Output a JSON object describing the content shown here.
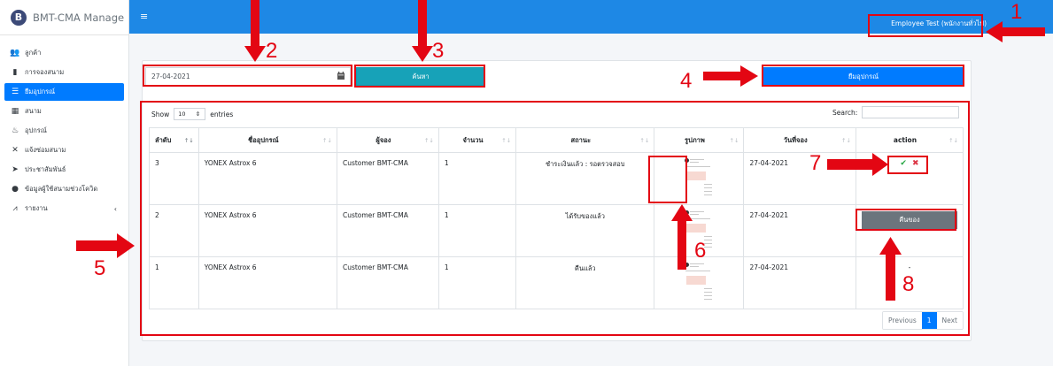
{
  "app": {
    "brand_letter": "B",
    "brand_name": "BMT-CMA Manage",
    "menu_icon": "hamburger-icon"
  },
  "sidebar": {
    "items": [
      {
        "label": "ลูกค้า",
        "icon": "users-icon",
        "glyph": "👥",
        "active": false
      },
      {
        "label": "การจองสนาม",
        "icon": "bookmark-icon",
        "glyph": "▮",
        "active": false
      },
      {
        "label": "ยืมอุปกรณ์",
        "icon": "list-icon",
        "glyph": "☰",
        "active": true
      },
      {
        "label": "สนาม",
        "icon": "building-icon",
        "glyph": "▦",
        "active": false
      },
      {
        "label": "อุปกรณ์",
        "icon": "equipment-icon",
        "glyph": "♨",
        "active": false
      },
      {
        "label": "แจ้งซ่อมสนาม",
        "icon": "tools-icon",
        "glyph": "✕",
        "active": false
      },
      {
        "label": "ประชาสัมพันธ์",
        "icon": "send-icon",
        "glyph": "➤",
        "active": false
      },
      {
        "label": "ข้อมูลผู้ใช้สนามช่วงโควิด",
        "icon": "user-icon",
        "glyph": "●",
        "active": false
      },
      {
        "label": "รายงาน",
        "icon": "chart-icon",
        "glyph": "⩘",
        "active": false,
        "caret": "‹"
      }
    ]
  },
  "topbar": {
    "user": "Employee Test (พนักงานทั่วไป)"
  },
  "filters": {
    "date_value": "27-04-2021",
    "search_button": "ค้นหา",
    "borrow_button": "ยืมอุปกรณ์"
  },
  "table_controls": {
    "show_label": "Show",
    "length_value": "10",
    "entries_label": "entries",
    "search_label": "Search:"
  },
  "table": {
    "headers": [
      "ลำดับ",
      "ชื่ออุปกรณ์",
      "ผู้จอง",
      "จำนวน",
      "สถานะ",
      "รูปภาพ",
      "วันที่จอง",
      "action"
    ],
    "rows": [
      {
        "no": "3",
        "equipment": "YONEX Astrox 6",
        "booker": "Customer BMT-CMA",
        "qty": "1",
        "status": "ชำระเงินแล้ว : รอตรวจสอบ",
        "date": "27-04-2021",
        "action": "approve-reject"
      },
      {
        "no": "2",
        "equipment": "YONEX Astrox 6",
        "booker": "Customer BMT-CMA",
        "qty": "1",
        "status": "ได้รับของแล้ว",
        "date": "27-04-2021",
        "action": "return",
        "action_label": "คืนของ"
      },
      {
        "no": "1",
        "equipment": "YONEX Astrox 6",
        "booker": "Customer BMT-CMA",
        "qty": "1",
        "status": "คืนแล้ว",
        "date": "27-04-2021",
        "action": "none",
        "action_label": "-"
      }
    ]
  },
  "pagination": {
    "prev": "Previous",
    "current": "1",
    "next": "Next"
  },
  "annotations": {
    "color": "#e30613",
    "labels": [
      "1",
      "2",
      "3",
      "4",
      "5",
      "6",
      "7",
      "8"
    ]
  }
}
